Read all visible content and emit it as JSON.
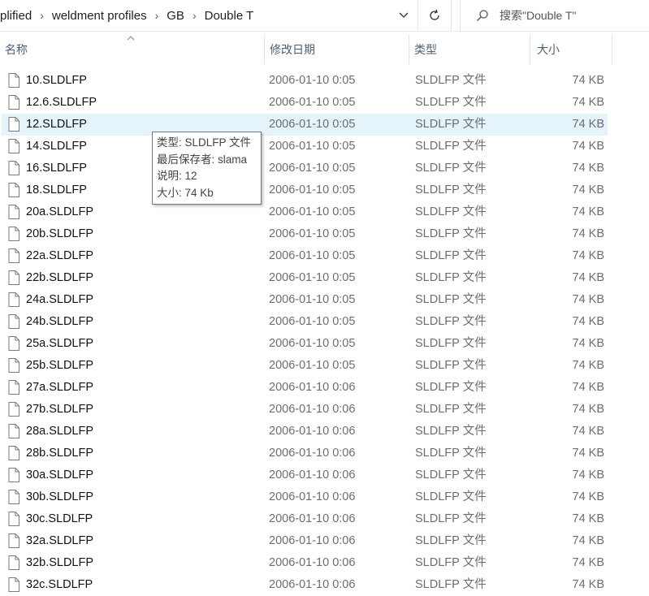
{
  "address_bar": {
    "crumbs": [
      "plified",
      "weldment profiles",
      "GB",
      "Double T"
    ],
    "search_placeholder": "搜索\"Double T\""
  },
  "columns": {
    "name": "名称",
    "date": "修改日期",
    "type": "类型",
    "size": "大小"
  },
  "files": [
    {
      "name": "10.SLDLFP",
      "date": "2006-01-10 0:05",
      "type": "SLDLFP 文件",
      "size": "74 KB"
    },
    {
      "name": "12.6.SLDLFP",
      "date": "2006-01-10 0:05",
      "type": "SLDLFP 文件",
      "size": "74 KB"
    },
    {
      "name": "12.SLDLFP",
      "date": "2006-01-10 0:05",
      "type": "SLDLFP 文件",
      "size": "74 KB"
    },
    {
      "name": "14.SLDLFP",
      "date": "2006-01-10 0:05",
      "type": "SLDLFP 文件",
      "size": "74 KB"
    },
    {
      "name": "16.SLDLFP",
      "date": "2006-01-10 0:05",
      "type": "SLDLFP 文件",
      "size": "74 KB"
    },
    {
      "name": "18.SLDLFP",
      "date": "2006-01-10 0:05",
      "type": "SLDLFP 文件",
      "size": "74 KB"
    },
    {
      "name": "20a.SLDLFP",
      "date": "2006-01-10 0:05",
      "type": "SLDLFP 文件",
      "size": "74 KB"
    },
    {
      "name": "20b.SLDLFP",
      "date": "2006-01-10 0:05",
      "type": "SLDLFP 文件",
      "size": "74 KB"
    },
    {
      "name": "22a.SLDLFP",
      "date": "2006-01-10 0:05",
      "type": "SLDLFP 文件",
      "size": "74 KB"
    },
    {
      "name": "22b.SLDLFP",
      "date": "2006-01-10 0:05",
      "type": "SLDLFP 文件",
      "size": "74 KB"
    },
    {
      "name": "24a.SLDLFP",
      "date": "2006-01-10 0:05",
      "type": "SLDLFP 文件",
      "size": "74 KB"
    },
    {
      "name": "24b.SLDLFP",
      "date": "2006-01-10 0:05",
      "type": "SLDLFP 文件",
      "size": "74 KB"
    },
    {
      "name": "25a.SLDLFP",
      "date": "2006-01-10 0:05",
      "type": "SLDLFP 文件",
      "size": "74 KB"
    },
    {
      "name": "25b.SLDLFP",
      "date": "2006-01-10 0:05",
      "type": "SLDLFP 文件",
      "size": "74 KB"
    },
    {
      "name": "27a.SLDLFP",
      "date": "2006-01-10 0:06",
      "type": "SLDLFP 文件",
      "size": "74 KB"
    },
    {
      "name": "27b.SLDLFP",
      "date": "2006-01-10 0:06",
      "type": "SLDLFP 文件",
      "size": "74 KB"
    },
    {
      "name": "28a.SLDLFP",
      "date": "2006-01-10 0:06",
      "type": "SLDLFP 文件",
      "size": "74 KB"
    },
    {
      "name": "28b.SLDLFP",
      "date": "2006-01-10 0:06",
      "type": "SLDLFP 文件",
      "size": "74 KB"
    },
    {
      "name": "30a.SLDLFP",
      "date": "2006-01-10 0:06",
      "type": "SLDLFP 文件",
      "size": "74 KB"
    },
    {
      "name": "30b.SLDLFP",
      "date": "2006-01-10 0:06",
      "type": "SLDLFP 文件",
      "size": "74 KB"
    },
    {
      "name": "30c.SLDLFP",
      "date": "2006-01-10 0:06",
      "type": "SLDLFP 文件",
      "size": "74 KB"
    },
    {
      "name": "32a.SLDLFP",
      "date": "2006-01-10 0:06",
      "type": "SLDLFP 文件",
      "size": "74 KB"
    },
    {
      "name": "32b.SLDLFP",
      "date": "2006-01-10 0:06",
      "type": "SLDLFP 文件",
      "size": "74 KB"
    },
    {
      "name": "32c.SLDLFP",
      "date": "2006-01-10 0:06",
      "type": "SLDLFP 文件",
      "size": "74 KB"
    }
  ],
  "hovered_index": 2,
  "tooltip": {
    "line1": "类型: SLDLFP 文件",
    "line2": "最后保存者: slama",
    "line3": "说明: 12",
    "line4": "大小: 74 Kb"
  },
  "colors": {
    "hover_row": "#e5f3fb",
    "header_text": "#4c607a",
    "secondary_text": "#6d6d6d"
  },
  "icons": {
    "file": "blank-file-icon",
    "dropdown": "chevron-down-icon",
    "refresh": "refresh-icon",
    "search": "search-icon",
    "sort": "sort-ascending-icon"
  }
}
